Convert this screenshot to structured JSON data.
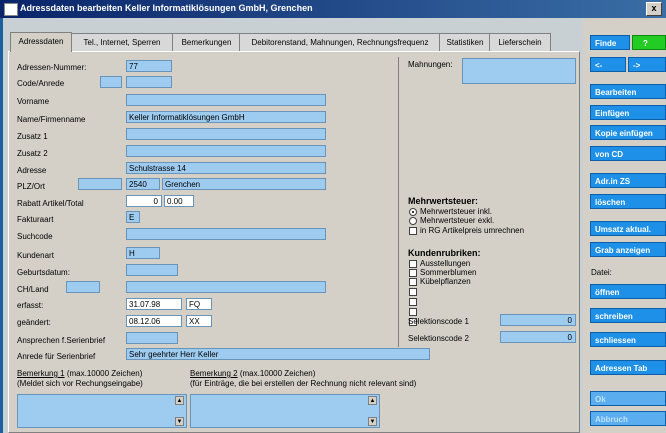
{
  "window": {
    "title": "Adressdaten bearbeiten Keller Informatiklösungen GmbH, Grenchen",
    "close_label": "x"
  },
  "tabs": [
    {
      "label": "Adressdaten"
    },
    {
      "label": "Tel., Internet, Sperren"
    },
    {
      "label": "Bemerkungen"
    },
    {
      "label": "Debitorenstand, Mahnungen, Rechnungsfrequenz"
    },
    {
      "label": "Statistiken"
    },
    {
      "label": "Lieferschein"
    }
  ],
  "form": {
    "adressen_nummer": {
      "label": "Adressen-Nummer:",
      "value": "77"
    },
    "code_anrede": {
      "label": "Code/Anrede",
      "code": "",
      "value": ""
    },
    "vorname": {
      "label": "Vorname",
      "value": ""
    },
    "name": {
      "label": "Name/Firmenname",
      "value": "Keller Informatiklösungen GmbH"
    },
    "zusatz1": {
      "label": "Zusatz 1",
      "value": ""
    },
    "zusatz2": {
      "label": "Zusatz 2",
      "value": ""
    },
    "adresse": {
      "label": "Adresse",
      "value": "Schulstrasse 14"
    },
    "plz_ort": {
      "label": "PLZ/Ort",
      "prefix": "",
      "plz": "2540",
      "ort": "Grenchen"
    },
    "rabatt": {
      "label": "Rabatt Artikel/Total",
      "artikel": "0",
      "total": "0.00"
    },
    "fakturaart": {
      "label": "Fakturaart",
      "value": "E"
    },
    "suchcode": {
      "label": "Suchcode",
      "value": ""
    },
    "kundenart": {
      "label": "Kundenart",
      "value": "H"
    },
    "geburtsdatum": {
      "label": "Geburtsdatum:",
      "value": ""
    },
    "ch_land": {
      "label": "CH/Land",
      "code": "",
      "value": ""
    },
    "erfasst": {
      "label": "erfasst:",
      "date": "31.07.98",
      "user": "FQ"
    },
    "geaendert": {
      "label": "geändert:",
      "date": "08.12.06",
      "user": "XX"
    },
    "ansprechen": {
      "label": "Ansprechen f.Serienbrief",
      "value": ""
    },
    "anrede_serienbrief": {
      "label": "Anrede für Serienbrief",
      "value": "Sehr geehrter Herr Keller"
    }
  },
  "remarks": {
    "bem1_title": "Bemerkung 1",
    "bem1_suffix": " (max.10000 Zeichen)",
    "bem1_hint": "(Meldet sich vor Rechungseingabe)",
    "bem2_title": "Bemerkung 2",
    "bem2_suffix": " (max.10000 Zeichen)",
    "bem2_hint": "(für Einträge, die bei erstellen der Rechnung nicht relevant sind)"
  },
  "right": {
    "mahnungen_label": "Mahnungen:",
    "mwst_title": "Mehrwertsteuer:",
    "mwst_options": [
      {
        "label": "Mehrwertsteuer inkl.",
        "selected": true
      },
      {
        "label": "Mehrwertsteuer exkl.",
        "selected": false
      }
    ],
    "rg_artikelpreis": {
      "label": "in RG Artikelpreis umrechnen",
      "checked": false
    },
    "kundenrubriken_title": "Kundenrubriken:",
    "rubriken": [
      {
        "label": "Ausstellungen"
      },
      {
        "label": "Sommerblumen"
      },
      {
        "label": "Kübelpflanzen"
      },
      {
        "label": ""
      },
      {
        "label": ""
      },
      {
        "label": ""
      },
      {
        "label": ""
      }
    ],
    "selektionscode1": {
      "label": "Selektionscode 1",
      "value": "0"
    },
    "selektionscode2": {
      "label": "Selektionscode 2",
      "value": "0"
    }
  },
  "sidebar": {
    "finde": "Finde",
    "help": "?",
    "prev": "<-",
    "next": "->",
    "bearbeiten": "Bearbeiten",
    "einfuegen": "Einfügen",
    "kopie_einfuegen": "Kopie einfügen",
    "von_cd": "von CD",
    "adr_in_zs": "Adr.in ZS",
    "loeschen": "löschen",
    "umsatz_aktual": "Umsatz aktual.",
    "grab_anzeigen": "Grab anzeigen",
    "datei_label": "Datei:",
    "oeffnen": "öffnen",
    "schreiben": "schreiben",
    "schliessen": "schliessen",
    "adressen_tab": "Adressen Tab",
    "ok": "Ok",
    "abbruch": "Abbruch"
  }
}
